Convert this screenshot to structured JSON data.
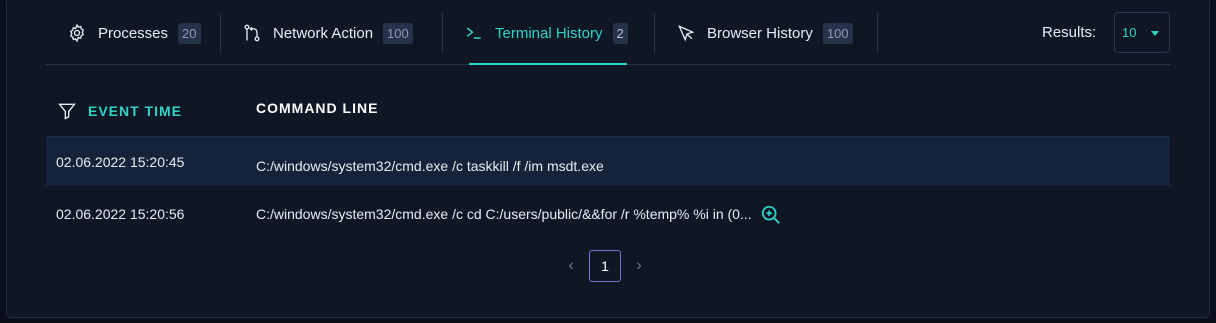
{
  "tabs": [
    {
      "label": "Processes",
      "count": "20",
      "icon": "gear-icon"
    },
    {
      "label": "Network Action",
      "count": "100",
      "icon": "network-branch-icon"
    },
    {
      "label": "Terminal History",
      "count": "2",
      "icon": "terminal-icon",
      "active": true
    },
    {
      "label": "Browser History",
      "count": "100",
      "icon": "cursor-pointer-icon"
    }
  ],
  "results": {
    "label": "Results:",
    "value": "10"
  },
  "table": {
    "headers": {
      "event_time": "EVENT TIME",
      "command_line": "COMMAND LINE"
    },
    "rows": [
      {
        "time": "02.06.2022 15:20:45",
        "command": "C:/windows/system32/cmd.exe /c taskkill /f /im msdt.exe"
      },
      {
        "time": "02.06.2022 15:20:56",
        "command": "C:/windows/system32/cmd.exe /c cd C:/users/public/&&for /r %temp% %i in (0..."
      }
    ]
  },
  "pagination": {
    "current": "1",
    "prev": "‹",
    "next": "›"
  },
  "colors": {
    "accent": "#2fd3c6",
    "background": "#0f1725",
    "row_highlight": "#15233a",
    "page_border": "#6f74d8"
  }
}
